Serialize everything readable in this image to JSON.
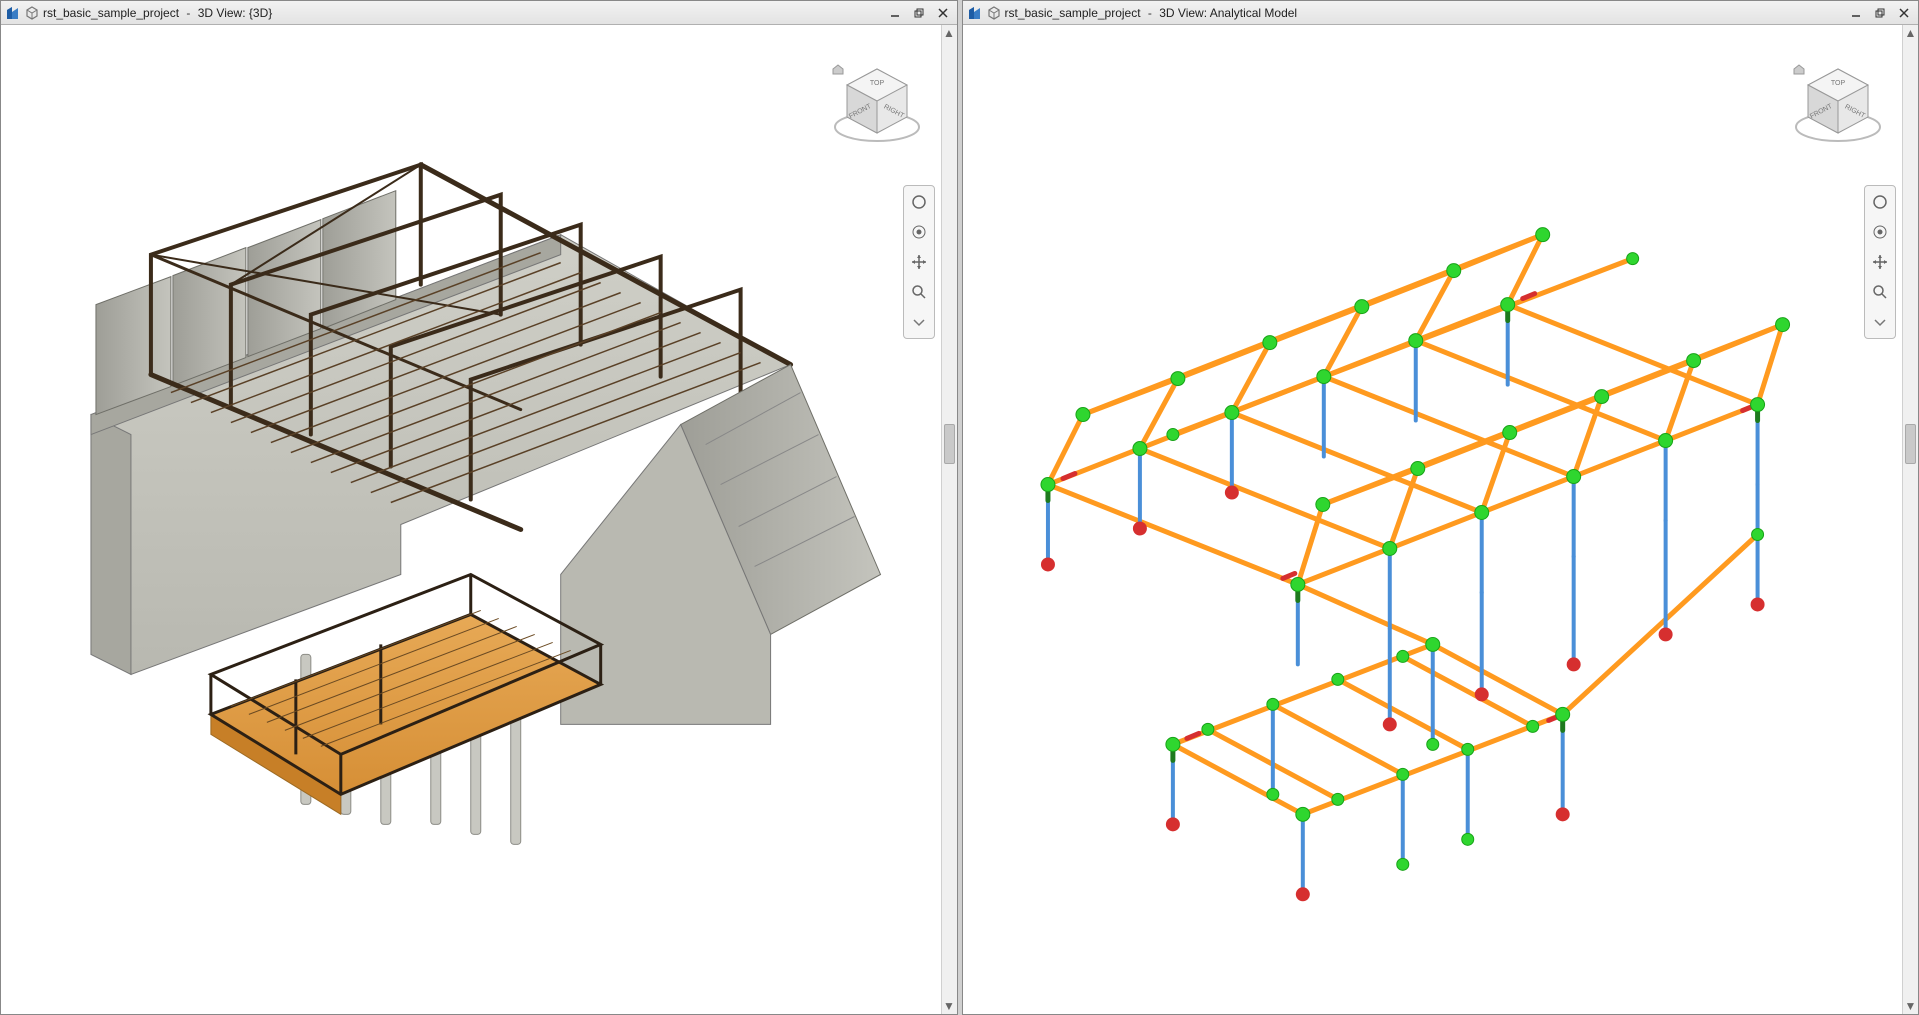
{
  "panes": [
    {
      "id": "left",
      "project": "rst_basic_sample_project",
      "view_label": "3D View: {3D}",
      "viewcube": {
        "top": "TOP",
        "front": "FRONT",
        "right": "RIGHT"
      }
    },
    {
      "id": "right",
      "project": "rst_basic_sample_project",
      "view_label": "3D View: Analytical Model",
      "viewcube": {
        "top": "TOP",
        "front": "FRONT",
        "right": "RIGHT"
      }
    }
  ],
  "window_controls": {
    "minimize": "–",
    "restore": "❐",
    "close": "✕"
  },
  "navbar_tools": [
    "home",
    "wheel",
    "pan",
    "zoom"
  ],
  "analytical_colors": {
    "beam": "#ff9a1f",
    "column": "#4a8fd8",
    "node": "#2fd62f",
    "release": "#d62f2f",
    "rigid": "#1e7a1e"
  }
}
